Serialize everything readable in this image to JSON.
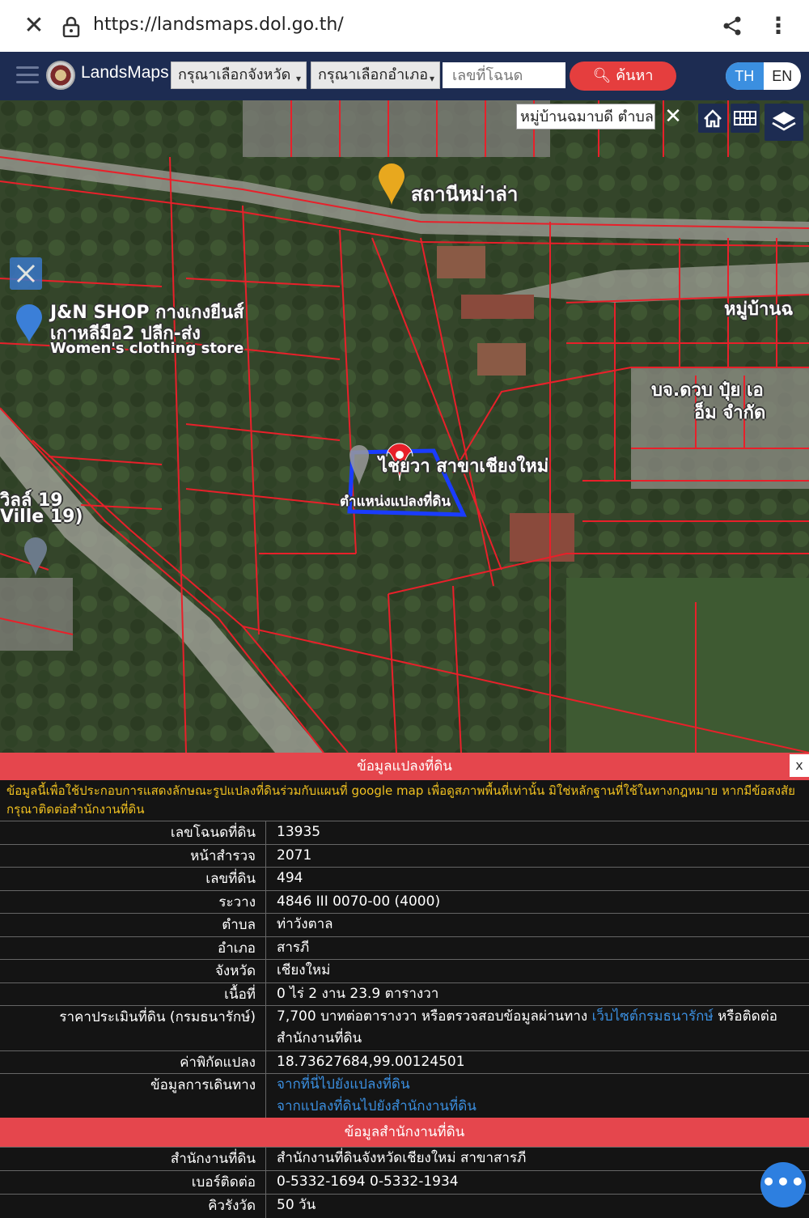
{
  "browser": {
    "url": "https://landsmaps.dol.go.th/"
  },
  "navbar": {
    "brand": "LandsMaps",
    "province_select": "กรุณาเลือกจังหวัด",
    "district_select": "กรุณาเลือกอำเภอ",
    "deed_placeholder": "เลขที่โฉนด",
    "search_label": "ค้นหา",
    "lang_th": "TH",
    "lang_en": "EN"
  },
  "map": {
    "search_value": "หมู่บ้านฉมาบดี ตำบล",
    "labels": {
      "poi_station": "สถานีหม่าล่า",
      "shop_line1": "J&N SHOP กางเกงยีนส์",
      "shop_line2": "เกาหลีมือ2 ปลีก-ส่ง",
      "shop_line3": "Women's clothing store",
      "village_edge": "หมู่บ้านฉ",
      "company_line1": "บจ.ดวบ ปุ๋ย เอ",
      "company_line2": "อ็ม จำกัด",
      "branch": "ไชยวา สาขาเชียงใหม่",
      "parcel_position": "ตำแหน่งแปลงที่ดิน",
      "ville_line1": "วิลล์ 19",
      "ville_line2": "Ville 19)"
    }
  },
  "panel": {
    "title": "ข้อมูลแปลงที่ดิน",
    "close": "x",
    "notice": "ข้อมูลนี้เพื่อใช้ประกอบการแสดงลักษณะรูปแปลงที่ดินร่วมกับแผนที่ google map เพื่อดูสภาพพื้นที่เท่านั้น มิใช่หลักฐานที่ใช้ในทางกฎหมาย หากมีข้อสงสัย กรุณาติดต่อสำนักงานที่ดิน",
    "rows": [
      {
        "key": "เลขโฉนดที่ดิน",
        "value": "13935"
      },
      {
        "key": "หน้าสำรวจ",
        "value": "2071"
      },
      {
        "key": "เลขที่ดิน",
        "value": "494"
      },
      {
        "key": "ระวาง",
        "value": "4846 III 0070-00 (4000)"
      },
      {
        "key": "ตำบล",
        "value": "ท่าวังตาล"
      },
      {
        "key": "อำเภอ",
        "value": "สารภี"
      },
      {
        "key": "จังหวัด",
        "value": "เชียงใหม่"
      },
      {
        "key": "เนื้อที่",
        "value": "0 ไร่ 2 งาน 23.9 ตารางวา"
      }
    ],
    "price": {
      "key": "ราคาประเมินที่ดิน (กรมธนารักษ์)",
      "value_prefix": "7,700 บาทต่อตารางวา หรือตรวจสอบข้อมูลผ่านทาง",
      "link": "เว็บไซต์กรมธนารักษ์",
      "value_suffix": "หรือติดต่อสำนักงานที่ดิน"
    },
    "coords": {
      "key": "ค่าพิกัดแปลง",
      "value": "18.73627684,99.00124501"
    },
    "directions": {
      "key": "ข้อมูลการเดินทาง",
      "link1": "จากที่นี่ไปยังแปลงที่ดิน",
      "link2": "จากแปลงที่ดินไปยังสำนักงานที่ดิน"
    },
    "office_section": "ข้อมูลสำนักงานที่ดิน",
    "office": {
      "key": "สำนักงานที่ดิน",
      "value": "สำนักงานที่ดินจังหวัดเชียงใหม่ สาขาสารภี"
    },
    "phone": {
      "key": "เบอร์ติดต่อ",
      "value": "0-5332-1694 0-5332-1934"
    },
    "queue": {
      "key": "คิวรังวัด",
      "value": "50 วัน"
    }
  },
  "colors": {
    "navbar": "#1d2c52",
    "accent_red": "#e53e3e",
    "parcel_outline": "#1a3cff",
    "boundary": "#e8202a",
    "link": "#3b8fe0"
  }
}
